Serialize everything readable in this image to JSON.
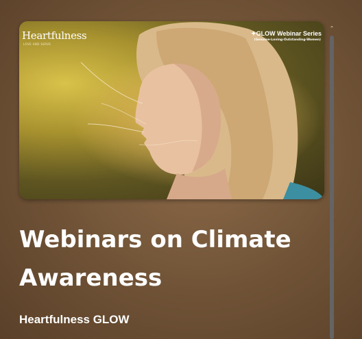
{
  "video": {
    "brand_logo_text": "Heartfulness",
    "brand_logo_subtext": "LOVE AND SERVE",
    "series_label": "GLOW Webinar Series",
    "series_subtitle": "(Genuine-Loving-Outstanding-Women)",
    "thumbnail_subject": "child-in-sunlight"
  },
  "title": "Webinars on Climate Awareness",
  "channel": "Heartfulness GLOW",
  "icons": {
    "scroll_up": "chevron-up-icon"
  },
  "colors": {
    "background": "#7a5a3c",
    "text": "#ffffff",
    "scrollbar": "#646464"
  }
}
